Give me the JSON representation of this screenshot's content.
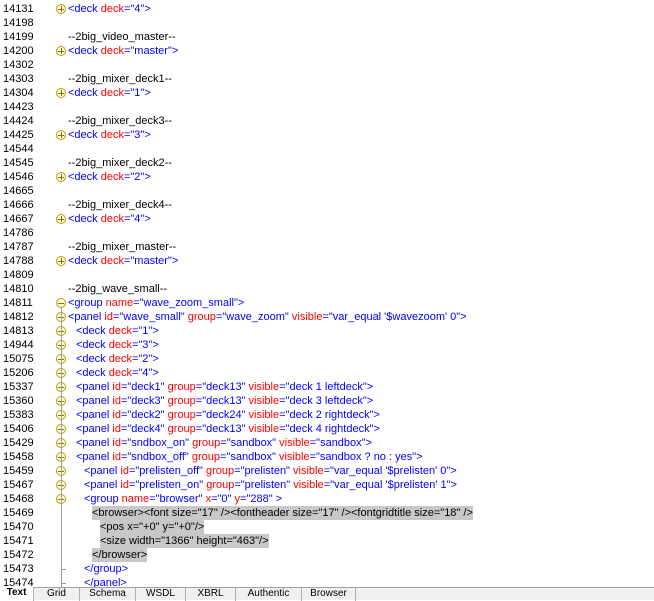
{
  "lines": [
    {
      "n": "14131",
      "fold": "plus",
      "indent": 0,
      "tokens": [
        [
          "tag",
          "<deck "
        ],
        [
          "attr",
          "deck"
        ],
        [
          "tag",
          "="
        ],
        [
          "val",
          "\"4\""
        ],
        [
          "tag",
          ">"
        ]
      ]
    },
    {
      "n": "14198",
      "fold": "none",
      "indent": 0,
      "tokens": []
    },
    {
      "n": "14199",
      "fold": "none",
      "indent": 0,
      "tokens": [
        [
          "txt",
          "--2big_video_master--"
        ]
      ]
    },
    {
      "n": "14200",
      "fold": "plus",
      "indent": 0,
      "tokens": [
        [
          "tag",
          "<deck "
        ],
        [
          "attr",
          "deck"
        ],
        [
          "tag",
          "="
        ],
        [
          "val",
          "\"master\""
        ],
        [
          "tag",
          ">"
        ]
      ]
    },
    {
      "n": "14302",
      "fold": "none",
      "indent": 0,
      "tokens": []
    },
    {
      "n": "14303",
      "fold": "none",
      "indent": 0,
      "tokens": [
        [
          "txt",
          "--2big_mixer_deck1--"
        ]
      ]
    },
    {
      "n": "14304",
      "fold": "plus",
      "indent": 0,
      "tokens": [
        [
          "tag",
          "<deck "
        ],
        [
          "attr",
          "deck"
        ],
        [
          "tag",
          "="
        ],
        [
          "val",
          "\"1\""
        ],
        [
          "tag",
          ">"
        ]
      ]
    },
    {
      "n": "14423",
      "fold": "none",
      "indent": 0,
      "tokens": []
    },
    {
      "n": "14424",
      "fold": "none",
      "indent": 0,
      "tokens": [
        [
          "txt",
          "--2big_mixer_deck3--"
        ]
      ]
    },
    {
      "n": "14425",
      "fold": "plus",
      "indent": 0,
      "tokens": [
        [
          "tag",
          "<deck "
        ],
        [
          "attr",
          "deck"
        ],
        [
          "tag",
          "="
        ],
        [
          "val",
          "\"3\""
        ],
        [
          "tag",
          ">"
        ]
      ]
    },
    {
      "n": "14544",
      "fold": "none",
      "indent": 0,
      "tokens": []
    },
    {
      "n": "14545",
      "fold": "none",
      "indent": 0,
      "tokens": [
        [
          "txt",
          "--2big_mixer_deck2--"
        ]
      ]
    },
    {
      "n": "14546",
      "fold": "plus",
      "indent": 0,
      "tokens": [
        [
          "tag",
          "<deck "
        ],
        [
          "attr",
          "deck"
        ],
        [
          "tag",
          "="
        ],
        [
          "val",
          "\"2\""
        ],
        [
          "tag",
          ">"
        ]
      ]
    },
    {
      "n": "14665",
      "fold": "none",
      "indent": 0,
      "tokens": []
    },
    {
      "n": "14666",
      "fold": "none",
      "indent": 0,
      "tokens": [
        [
          "txt",
          "--2big_mixer_deck4--"
        ]
      ]
    },
    {
      "n": "14667",
      "fold": "plus",
      "indent": 0,
      "tokens": [
        [
          "tag",
          "<deck "
        ],
        [
          "attr",
          "deck"
        ],
        [
          "tag",
          "="
        ],
        [
          "val",
          "\"4\""
        ],
        [
          "tag",
          ">"
        ]
      ]
    },
    {
      "n": "14786",
      "fold": "none",
      "indent": 0,
      "tokens": []
    },
    {
      "n": "14787",
      "fold": "none",
      "indent": 0,
      "tokens": [
        [
          "txt",
          "--2big_mixer_master--"
        ]
      ]
    },
    {
      "n": "14788",
      "fold": "plus",
      "indent": 0,
      "tokens": [
        [
          "tag",
          "<deck "
        ],
        [
          "attr",
          "deck"
        ],
        [
          "tag",
          "="
        ],
        [
          "val",
          "\"master\""
        ],
        [
          "tag",
          ">"
        ]
      ]
    },
    {
      "n": "14809",
      "fold": "none",
      "indent": 0,
      "tokens": []
    },
    {
      "n": "14810",
      "fold": "none",
      "indent": 0,
      "tokens": [
        [
          "txt",
          "--2big_wave_small--"
        ]
      ]
    },
    {
      "n": "14811",
      "fold": "minus",
      "indent": 0,
      "tokens": [
        [
          "tag",
          "<group "
        ],
        [
          "attr",
          "name"
        ],
        [
          "tag",
          "="
        ],
        [
          "val",
          "\"wave_zoom_small\""
        ],
        [
          "tag",
          ">"
        ]
      ]
    },
    {
      "n": "14812",
      "fold": "minus",
      "indent": 0,
      "tokens": [
        [
          "tag",
          "<panel "
        ],
        [
          "attr",
          "id"
        ],
        [
          "tag",
          "="
        ],
        [
          "val",
          "\"wave_small\" "
        ],
        [
          "attr",
          "group"
        ],
        [
          "tag",
          "="
        ],
        [
          "val",
          "\"wave_zoom\" "
        ],
        [
          "attr",
          "visible"
        ],
        [
          "tag",
          "="
        ],
        [
          "val",
          "\"var_equal '$wavezoom' 0\""
        ],
        [
          "tag",
          ">"
        ]
      ]
    },
    {
      "n": "14813",
      "fold": "plus",
      "indent": 1,
      "tokens": [
        [
          "tag",
          "<deck "
        ],
        [
          "attr",
          "deck"
        ],
        [
          "tag",
          "="
        ],
        [
          "val",
          "\"1\""
        ],
        [
          "tag",
          ">"
        ]
      ]
    },
    {
      "n": "14944",
      "fold": "plus",
      "indent": 1,
      "tokens": [
        [
          "tag",
          "<deck "
        ],
        [
          "attr",
          "deck"
        ],
        [
          "tag",
          "="
        ],
        [
          "val",
          "\"3\""
        ],
        [
          "tag",
          ">"
        ]
      ]
    },
    {
      "n": "15075",
      "fold": "plus",
      "indent": 1,
      "tokens": [
        [
          "tag",
          "<deck "
        ],
        [
          "attr",
          "deck"
        ],
        [
          "tag",
          "="
        ],
        [
          "val",
          "\"2\""
        ],
        [
          "tag",
          ">"
        ]
      ]
    },
    {
      "n": "15206",
      "fold": "plus",
      "indent": 1,
      "tokens": [
        [
          "tag",
          "<deck "
        ],
        [
          "attr",
          "deck"
        ],
        [
          "tag",
          "="
        ],
        [
          "val",
          "\"4\""
        ],
        [
          "tag",
          ">"
        ]
      ]
    },
    {
      "n": "15337",
      "fold": "plus",
      "indent": 1,
      "tokens": [
        [
          "tag",
          "<panel "
        ],
        [
          "attr",
          "id"
        ],
        [
          "tag",
          "="
        ],
        [
          "val",
          "\"deck1\" "
        ],
        [
          "attr",
          "group"
        ],
        [
          "tag",
          "="
        ],
        [
          "val",
          "\"deck13\" "
        ],
        [
          "attr",
          "visible"
        ],
        [
          "tag",
          "="
        ],
        [
          "val",
          "\"deck 1 leftdeck\""
        ],
        [
          "tag",
          ">"
        ]
      ]
    },
    {
      "n": "15360",
      "fold": "plus",
      "indent": 1,
      "tokens": [
        [
          "tag",
          "<panel "
        ],
        [
          "attr",
          "id"
        ],
        [
          "tag",
          "="
        ],
        [
          "val",
          "\"deck3\" "
        ],
        [
          "attr",
          "group"
        ],
        [
          "tag",
          "="
        ],
        [
          "val",
          "\"deck13\" "
        ],
        [
          "attr",
          "visible"
        ],
        [
          "tag",
          "="
        ],
        [
          "val",
          "\"deck 3 leftdeck\""
        ],
        [
          "tag",
          ">"
        ]
      ]
    },
    {
      "n": "15383",
      "fold": "plus",
      "indent": 1,
      "tokens": [
        [
          "tag",
          "<panel "
        ],
        [
          "attr",
          "id"
        ],
        [
          "tag",
          "="
        ],
        [
          "val",
          "\"deck2\" "
        ],
        [
          "attr",
          "group"
        ],
        [
          "tag",
          "="
        ],
        [
          "val",
          "\"deck24\" "
        ],
        [
          "attr",
          "visible"
        ],
        [
          "tag",
          "="
        ],
        [
          "val",
          "\"deck 2 rightdeck\""
        ],
        [
          "tag",
          ">"
        ]
      ]
    },
    {
      "n": "15406",
      "fold": "plus",
      "indent": 1,
      "tokens": [
        [
          "tag",
          "<panel "
        ],
        [
          "attr",
          "id"
        ],
        [
          "tag",
          "="
        ],
        [
          "val",
          "\"deck4\" "
        ],
        [
          "attr",
          "group"
        ],
        [
          "tag",
          "="
        ],
        [
          "val",
          "\"deck13\" "
        ],
        [
          "attr",
          "visible"
        ],
        [
          "tag",
          "="
        ],
        [
          "val",
          "\"deck 4 rightdeck\""
        ],
        [
          "tag",
          ">"
        ]
      ]
    },
    {
      "n": "15429",
      "fold": "plus",
      "indent": 1,
      "tokens": [
        [
          "tag",
          "<panel "
        ],
        [
          "attr",
          "id"
        ],
        [
          "tag",
          "="
        ],
        [
          "val",
          "\"sndbox_on\" "
        ],
        [
          "attr",
          "group"
        ],
        [
          "tag",
          "="
        ],
        [
          "val",
          "\"sandbox\" "
        ],
        [
          "attr",
          "visible"
        ],
        [
          "tag",
          "="
        ],
        [
          "val",
          "\"sandbox\""
        ],
        [
          "tag",
          ">"
        ]
      ]
    },
    {
      "n": "15458",
      "fold": "minus",
      "indent": 1,
      "tokens": [
        [
          "tag",
          "<panel "
        ],
        [
          "attr",
          "id"
        ],
        [
          "tag",
          "="
        ],
        [
          "val",
          "\"sndbox_off\" "
        ],
        [
          "attr",
          "group"
        ],
        [
          "tag",
          "="
        ],
        [
          "val",
          "\"sandbox\" "
        ],
        [
          "attr",
          "visible"
        ],
        [
          "tag",
          "="
        ],
        [
          "val",
          "\"sandbox ? no : yes\""
        ],
        [
          "tag",
          ">"
        ]
      ]
    },
    {
      "n": "15459",
      "fold": "plus",
      "indent": 2,
      "tokens": [
        [
          "tag",
          "<panel "
        ],
        [
          "attr",
          "id"
        ],
        [
          "tag",
          "="
        ],
        [
          "val",
          "\"prelisten_off\" "
        ],
        [
          "attr",
          "group"
        ],
        [
          "tag",
          "="
        ],
        [
          "val",
          "\"prelisten\" "
        ],
        [
          "attr",
          "visible"
        ],
        [
          "tag",
          "="
        ],
        [
          "val",
          "\"var_equal '$prelisten' 0\""
        ],
        [
          "tag",
          ">"
        ]
      ]
    },
    {
      "n": "15467",
      "fold": "plus",
      "indent": 2,
      "tokens": [
        [
          "tag",
          "<panel "
        ],
        [
          "attr",
          "id"
        ],
        [
          "tag",
          "="
        ],
        [
          "val",
          "\"prelisten_on\" "
        ],
        [
          "attr",
          "group"
        ],
        [
          "tag",
          "="
        ],
        [
          "val",
          "\"prelisten\" "
        ],
        [
          "attr",
          "visible"
        ],
        [
          "tag",
          "="
        ],
        [
          "val",
          "\"var_equal '$prelisten' 1\""
        ],
        [
          "tag",
          ">"
        ]
      ]
    },
    {
      "n": "15468",
      "fold": "minus",
      "indent": 2,
      "tokens": [
        [
          "tag",
          "<group "
        ],
        [
          "attr",
          "name"
        ],
        [
          "tag",
          "="
        ],
        [
          "val",
          "\"browser\" "
        ],
        [
          "attr",
          "x"
        ],
        [
          "tag",
          "="
        ],
        [
          "val",
          "\"0\" "
        ],
        [
          "attr",
          "y"
        ],
        [
          "tag",
          "="
        ],
        [
          "val",
          "\"288\" "
        ],
        [
          "tag",
          ">"
        ]
      ]
    },
    {
      "n": "15469",
      "fold": "none",
      "indent": 3,
      "sel": true,
      "tokens": [
        [
          "txt",
          "<browser><font size=\"17\" /><fontheader size=\"17\" /><fontgridtitle size=\"18\" />"
        ]
      ]
    },
    {
      "n": "15470",
      "fold": "none",
      "indent": 4,
      "sel": true,
      "tokens": [
        [
          "txt",
          "<pos x=\"+0\" y=\"+0\"/>"
        ]
      ]
    },
    {
      "n": "15471",
      "fold": "none",
      "indent": 4,
      "sel": true,
      "tokens": [
        [
          "txt",
          "<size width=\"1366\" height=\"463\"/>"
        ]
      ]
    },
    {
      "n": "15472",
      "fold": "none",
      "indent": 3,
      "sel": true,
      "tokens": [
        [
          "txt",
          "</browser>"
        ]
      ]
    },
    {
      "n": "15473",
      "fold": "none",
      "indent": 2,
      "tokens": [
        [
          "tag",
          "</group>"
        ]
      ]
    },
    {
      "n": "15474",
      "fold": "none",
      "indent": 2,
      "tokens": [
        [
          "tag",
          "</panel>"
        ]
      ]
    }
  ],
  "tabs": [
    {
      "label": "Text",
      "active": true
    },
    {
      "label": "Grid",
      "active": false
    },
    {
      "label": "Schema",
      "active": false
    },
    {
      "label": "WSDL",
      "active": false
    },
    {
      "label": "XBRL",
      "active": false
    },
    {
      "label": "Authentic",
      "active": false
    },
    {
      "label": "Browser",
      "active": false
    }
  ]
}
